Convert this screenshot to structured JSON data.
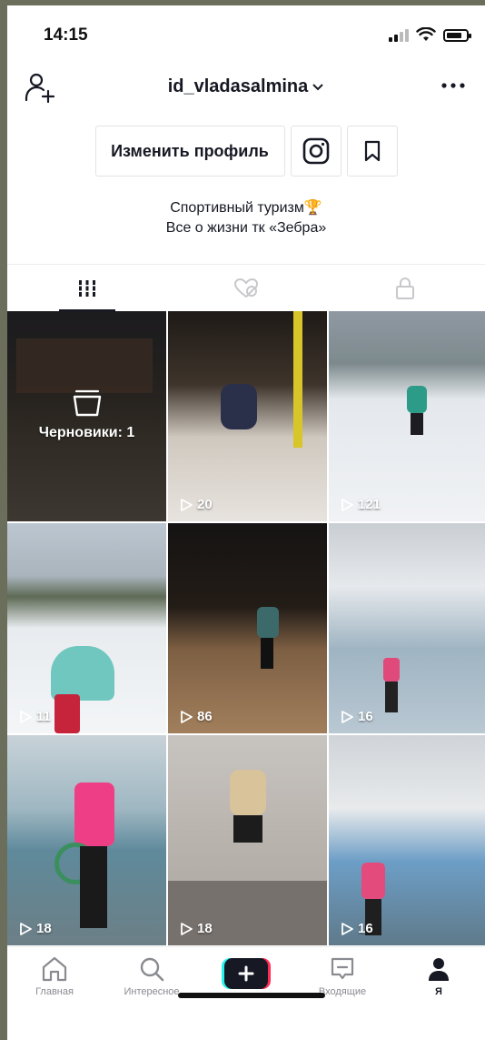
{
  "status": {
    "time": "14:15"
  },
  "header": {
    "username": "id_vladasalmina"
  },
  "profile": {
    "edit_label": "Изменить профиль",
    "bio_line1": "Спортивный туризм🏆",
    "bio_line2": "Все о жизни тк «Зебра»"
  },
  "tabs": [
    {
      "name": "videos",
      "icon": "grid-icon",
      "active": true
    },
    {
      "name": "liked",
      "icon": "heart-hidden-icon",
      "active": false
    },
    {
      "name": "private",
      "icon": "lock-icon",
      "active": false
    }
  ],
  "drafts": {
    "label": "Черновики: 1"
  },
  "videos": [
    {
      "views": "20"
    },
    {
      "views": "121"
    },
    {
      "views": "11"
    },
    {
      "views": "86"
    },
    {
      "views": "16"
    },
    {
      "views": "18"
    },
    {
      "views": "18"
    },
    {
      "views": "16"
    }
  ],
  "bottom_nav": {
    "home": "Главная",
    "discover": "Интересное",
    "inbox": "Входящие",
    "me": "Я"
  },
  "colors": {
    "accent_pink": "#fe2c55",
    "accent_cyan": "#25f4ee",
    "text": "#161823",
    "muted": "#8a8b91"
  }
}
